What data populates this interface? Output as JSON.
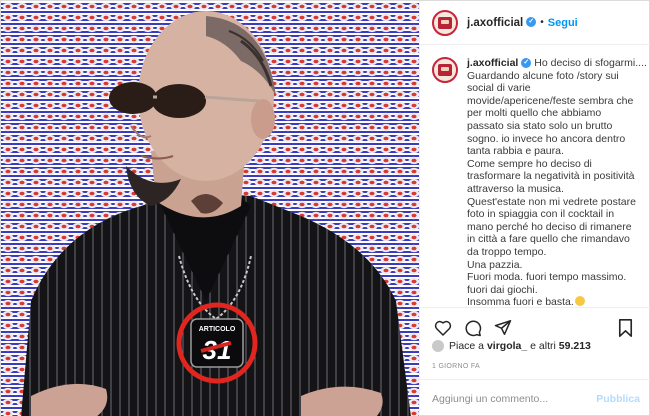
{
  "post": {
    "username": "j.axofficial",
    "follow_label": "Segui",
    "follow_separator": "•",
    "verified_mark": "✓",
    "caption_lines": [
      "Ho deciso di sfogarmi....",
      "Guardando alcune foto /story sui",
      "social di varie",
      "movide/apericene/feste sembra che",
      "per molti quello che abbiamo",
      "passato sia stato solo un brutto",
      "sogno. io invece ho ancora dentro",
      "tanta rabbia e paura.",
      "Come sempre ho deciso di",
      "trasformare la negatività in positività",
      "attraverso la musica.",
      "Quest'estate non mi vedrete postare",
      "foto in spiaggia con il cocktail in",
      "mano perché ho deciso di rimanere",
      "in città a fare quello che rimandavo",
      "da troppo tempo.",
      "Una pazzia.",
      "Fuori moda. fuori tempo massimo.",
      "fuori dai giochi.",
      "Insomma fuori e basta."
    ],
    "likes_prefix": "Piace a",
    "likes_user": "virgola_",
    "likes_middle": "e altri",
    "likes_count": "59.213",
    "timestamp": "1 GIORNO FA",
    "comment_placeholder": "Aggiungi un commento...",
    "publish_label": "Pubblica"
  },
  "photo": {
    "pendant_text_top": "ARTICOLO",
    "pendant_text_number": "31"
  },
  "colors": {
    "accent_link": "#0095f6",
    "verified": "#3897f0",
    "highlight_circle": "#e0261f"
  },
  "icons": [
    "heart-icon",
    "comment-icon",
    "share-icon",
    "bookmark-icon",
    "verified-icon",
    "emoji-laughing-icon"
  ]
}
